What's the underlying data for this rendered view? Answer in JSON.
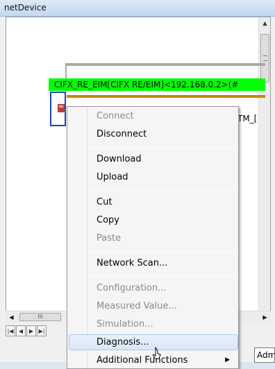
{
  "window": {
    "title": "netDevice"
  },
  "device": {
    "label": "CIFX_RE_EIM[CIFX RE/EIM]<192.168.0.2>(#",
    "second_label": "TM_["
  },
  "context_menu": {
    "groups": [
      [
        {
          "label": "Connect",
          "enabled": false
        },
        {
          "label": "Disconnect",
          "enabled": true
        }
      ],
      [
        {
          "label": "Download",
          "enabled": true
        },
        {
          "label": "Upload",
          "enabled": true
        }
      ],
      [
        {
          "label": "Cut",
          "enabled": true
        },
        {
          "label": "Copy",
          "enabled": true
        },
        {
          "label": "Paste",
          "enabled": false
        }
      ],
      [
        {
          "label": "Network Scan...",
          "enabled": true
        }
      ],
      [
        {
          "label": "Configuration...",
          "enabled": false
        },
        {
          "label": "Measured Value...",
          "enabled": false
        },
        {
          "label": "Simulation...",
          "enabled": false
        },
        {
          "label": "Diagnosis...",
          "enabled": true,
          "highlighted": true
        },
        {
          "label": "Additional Functions",
          "enabled": true,
          "submenu": true
        }
      ]
    ]
  },
  "status": {
    "admin_label": "Admi"
  },
  "colors": {
    "device_bar": "#00ff00",
    "bus_orange": "#c8860a",
    "selection_border": "#1a3fd0"
  },
  "icons": {
    "scroll_up": "▲",
    "scroll_down": "▼",
    "scroll_left": "◀",
    "scroll_right": "▶",
    "nav_first": "|◀",
    "nav_prev": "◀",
    "nav_next": "▶",
    "nav_last": "▶|",
    "submenu_arrow": "▶"
  }
}
